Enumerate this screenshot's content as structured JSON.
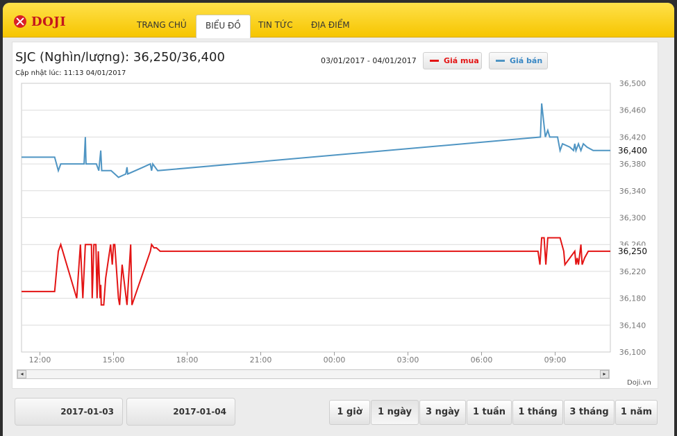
{
  "header": {
    "brand": "DOJI",
    "nav": [
      "TRANG CHỦ",
      "BIỂU ĐỒ",
      "TIN TỨC",
      "ĐỊA ĐIỂM"
    ]
  },
  "title": "SJC (Nghìn/lượng): 36,250/36,400",
  "updated": "Cập nhật lúc: 11:13 04/01/2017",
  "range": "03/01/2017 - 04/01/2017",
  "legend": {
    "buy_label": "Giá mua",
    "sell_label": "Giá bán",
    "buy_color": "#e31414",
    "sell_color": "#4f95c3"
  },
  "credit": "Doji.vn",
  "dates": [
    "2017-01-03",
    "2017-01-04"
  ],
  "periods": [
    "1 giờ",
    "1 ngày",
    "3 ngày",
    "1 tuần",
    "1 tháng",
    "3 tháng",
    "1 năm"
  ],
  "active_period": "1 ngày",
  "chart_data": {
    "type": "line",
    "x_axis": {
      "unit": "hours since 03/01/2017 00:00",
      "range": [
        11.25,
        35.25
      ],
      "ticks": [
        12,
        15,
        18,
        21,
        24,
        27,
        30,
        33
      ],
      "tick_labels": [
        "12:00",
        "15:00",
        "18:00",
        "21:00",
        "00:00",
        "03:00",
        "06:00",
        "09:00"
      ]
    },
    "y_axis": {
      "range": [
        36100,
        36500
      ],
      "ticks": [
        36100,
        36140,
        36180,
        36220,
        36260,
        36300,
        36340,
        36380,
        36420,
        36460,
        36500
      ],
      "tick_labels": [
        "36,100",
        "36,140",
        "36,180",
        "36,220",
        "36,260",
        "36,300",
        "36,340",
        "36,380",
        "36,420",
        "36,460",
        "36,500"
      ],
      "position": "right"
    },
    "grid": true,
    "series": [
      {
        "name": "Giá bán",
        "color": "#4f95c3",
        "last_label": "36,400",
        "points": [
          [
            11.25,
            36390
          ],
          [
            12.6,
            36390
          ],
          [
            12.75,
            36370
          ],
          [
            12.85,
            36380
          ],
          [
            13.8,
            36380
          ],
          [
            13.85,
            36420
          ],
          [
            13.88,
            36380
          ],
          [
            14.3,
            36380
          ],
          [
            14.4,
            36370
          ],
          [
            14.48,
            36400
          ],
          [
            14.52,
            36370
          ],
          [
            14.9,
            36370
          ],
          [
            15.2,
            36360
          ],
          [
            15.5,
            36365
          ],
          [
            15.55,
            36375
          ],
          [
            15.58,
            36365
          ],
          [
            16.2,
            36375
          ],
          [
            16.5,
            36380
          ],
          [
            16.55,
            36370
          ],
          [
            16.6,
            36380
          ],
          [
            16.8,
            36370
          ],
          [
            32.4,
            36420
          ],
          [
            32.45,
            36470
          ],
          [
            32.6,
            36420
          ],
          [
            32.7,
            36430
          ],
          [
            32.78,
            36420
          ],
          [
            33.1,
            36420
          ],
          [
            33.2,
            36400
          ],
          [
            33.3,
            36410
          ],
          [
            33.6,
            36405
          ],
          [
            33.75,
            36400
          ],
          [
            33.8,
            36410
          ],
          [
            33.85,
            36400
          ],
          [
            33.95,
            36410
          ],
          [
            34.05,
            36400
          ],
          [
            34.15,
            36410
          ],
          [
            34.3,
            36405
          ],
          [
            34.55,
            36400
          ],
          [
            35.25,
            36400
          ]
        ]
      },
      {
        "name": "Giá mua",
        "color": "#e31414",
        "last_label": "36,250",
        "points": [
          [
            11.25,
            36190
          ],
          [
            12.6,
            36190
          ],
          [
            12.75,
            36250
          ],
          [
            12.85,
            36260
          ],
          [
            13.5,
            36180
          ],
          [
            13.65,
            36260
          ],
          [
            13.75,
            36180
          ],
          [
            13.85,
            36260
          ],
          [
            14.1,
            36260
          ],
          [
            14.13,
            36180
          ],
          [
            14.2,
            36260
          ],
          [
            14.28,
            36260
          ],
          [
            14.33,
            36180
          ],
          [
            14.38,
            36250
          ],
          [
            14.45,
            36180
          ],
          [
            14.48,
            36200
          ],
          [
            14.5,
            36170
          ],
          [
            14.6,
            36170
          ],
          [
            14.68,
            36210
          ],
          [
            14.88,
            36260
          ],
          [
            14.95,
            36230
          ],
          [
            15.0,
            36260
          ],
          [
            15.05,
            36260
          ],
          [
            15.2,
            36180
          ],
          [
            15.25,
            36170
          ],
          [
            15.35,
            36230
          ],
          [
            15.55,
            36170
          ],
          [
            15.7,
            36260
          ],
          [
            15.75,
            36170
          ],
          [
            16.5,
            36250
          ],
          [
            16.55,
            36260
          ],
          [
            16.65,
            36255
          ],
          [
            16.75,
            36255
          ],
          [
            16.9,
            36250
          ],
          [
            32.3,
            36250
          ],
          [
            32.38,
            36230
          ],
          [
            32.45,
            36270
          ],
          [
            32.55,
            36270
          ],
          [
            32.62,
            36230
          ],
          [
            32.7,
            36270
          ],
          [
            33.2,
            36270
          ],
          [
            33.35,
            36250
          ],
          [
            33.4,
            36230
          ],
          [
            33.8,
            36250
          ],
          [
            33.85,
            36230
          ],
          [
            33.9,
            36240
          ],
          [
            33.95,
            36230
          ],
          [
            34.05,
            36260
          ],
          [
            34.1,
            36230
          ],
          [
            34.2,
            36240
          ],
          [
            34.35,
            36250
          ],
          [
            35.25,
            36250
          ]
        ]
      }
    ]
  }
}
